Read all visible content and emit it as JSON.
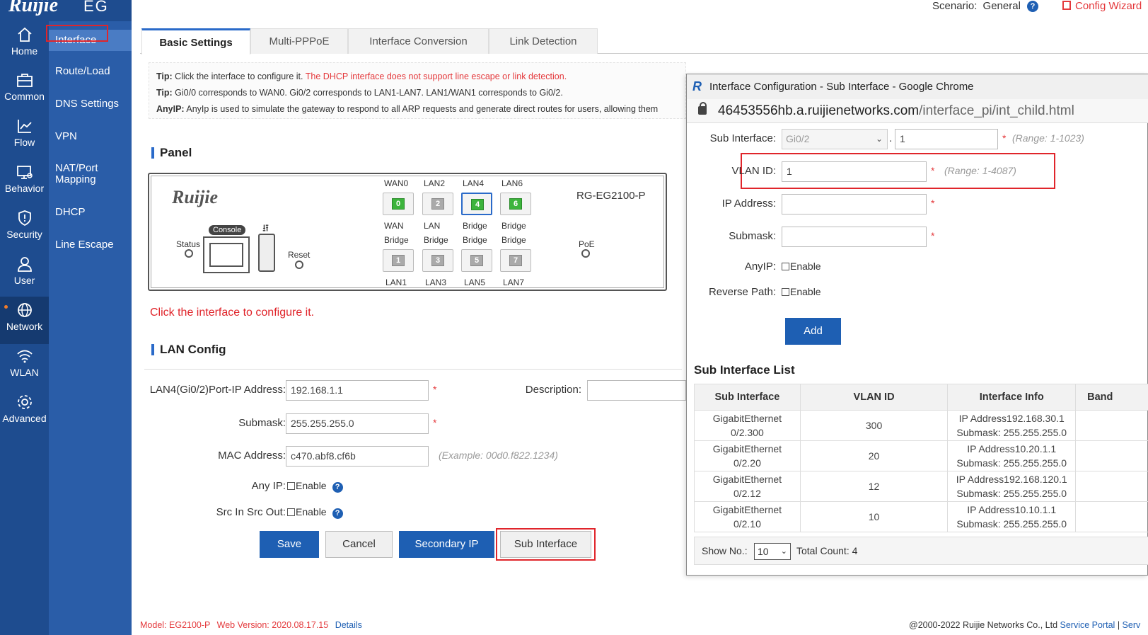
{
  "header": {
    "brand": "Ruijie",
    "product": "EG",
    "scenario_label": "Scenario:",
    "scenario_value": "General",
    "config_wizard": "Config Wizard"
  },
  "nav": {
    "items": [
      {
        "label": "Home",
        "icon": "home-icon"
      },
      {
        "label": "Common",
        "icon": "toolbox-icon"
      },
      {
        "label": "Flow",
        "icon": "chart-line-icon"
      },
      {
        "label": "Behavior",
        "icon": "monitor-icon"
      },
      {
        "label": "Security",
        "icon": "shield-icon"
      },
      {
        "label": "User",
        "icon": "user-icon"
      },
      {
        "label": "Network",
        "icon": "globe-icon"
      },
      {
        "label": "WLAN",
        "icon": "wifi-icon"
      },
      {
        "label": "Advanced",
        "icon": "gear-icon"
      }
    ],
    "active": "Network"
  },
  "submenu": {
    "items": [
      "Interface",
      "Route/Load",
      "DNS Settings",
      "VPN",
      "NAT/Port Mapping",
      "DHCP",
      "Line Escape"
    ],
    "nat_line1": "NAT/Port",
    "nat_line2": "Mapping"
  },
  "tabs": [
    "Basic Settings",
    "Multi-PPPoE",
    "Interface Conversion",
    "Link Detection"
  ],
  "tips": {
    "tip1_label": "Tip:",
    "tip1_text": "Click the interface to configure it.",
    "tip1_red": "The DHCP interface does not support line escape or link detection.",
    "tip2_label": "Tip:",
    "tip2_text": "Gi0/0 corresponds to WAN0. Gi0/2 corresponds to LAN1-LAN7. LAN1/WAN1 corresponds to Gi0/2.",
    "tip3_label": "AnyIP:",
    "tip3_text": "AnyIp is used to simulate the gateway to respond to all ARP requests and generate direct routes for users, allowing them"
  },
  "panel": {
    "title": "Panel",
    "brand": "Ruijie",
    "model": "RG-EG2100-P",
    "status_label": "Status",
    "console_label": "Console",
    "reset_label": "Reset",
    "poe_label": "PoE",
    "usb_symbol": "⭿",
    "top_ports": [
      {
        "name": "WAN0",
        "num": "0",
        "up": true,
        "role1": "WAN",
        "role2": "Bridge"
      },
      {
        "name": "LAN2",
        "num": "2",
        "up": false,
        "role1": "LAN",
        "role2": "Bridge"
      },
      {
        "name": "LAN4",
        "num": "4",
        "up": true,
        "role1": "Bridge",
        "role2": "Bridge"
      },
      {
        "name": "LAN6",
        "num": "6",
        "up": true,
        "role1": "Bridge",
        "role2": "Bridge"
      }
    ],
    "bottom_ports": [
      {
        "name": "LAN1",
        "num": "1",
        "up": false
      },
      {
        "name": "LAN3",
        "num": "3",
        "up": false
      },
      {
        "name": "LAN5",
        "num": "5",
        "up": false
      },
      {
        "name": "LAN7",
        "num": "7",
        "up": false
      }
    ]
  },
  "click_hint": "Click the interface to configure it.",
  "lan_config": {
    "title": "LAN Config",
    "port_ip_label": "LAN4(Gi0/2)Port-IP Address:",
    "port_ip_value": "192.168.1.1",
    "description_label": "Description:",
    "submask_label": "Submask:",
    "submask_value": "255.255.255.0",
    "mac_label": "MAC Address:",
    "mac_value": "c470.abf8.cf6b",
    "mac_hint": "(Example: 00d0.f822.1234)",
    "anyip_label": "Any IP:",
    "src_label": "Src In Src Out:",
    "enable": "Enable",
    "required": "*",
    "help": "?"
  },
  "buttons": {
    "save": "Save",
    "cancel": "Cancel",
    "secondary_ip": "Secondary IP",
    "sub_interface": "Sub Interface"
  },
  "footer": {
    "model_label": "Model:",
    "model_value": "EG2100-P",
    "web_label": "Web Version:",
    "web_value": "2020.08.17.15",
    "details": "Details",
    "copyright": "@2000-2022 Ruijie Networks Co., Ltd",
    "service_portal": "Service Portal",
    "sep": "|",
    "serv": "Serv"
  },
  "popup": {
    "title": "Interface Configuration - Sub Interface - Google Chrome",
    "url_domain": "46453556hb.a.ruijienetworks.com",
    "url_path": "/interface_pi/int_child.html",
    "sub_if_label": "Sub Interface:",
    "sub_if_select": "Gi0/2",
    "sub_if_dot": ".",
    "sub_if_value": "1",
    "sub_if_range": "(Range: 1-1023)",
    "vlan_label": "VLAN ID:",
    "vlan_value": "1",
    "vlan_range": "(Range: 1-4087)",
    "ip_label": "IP Address:",
    "submask_label": "Submask:",
    "anyip_label": "AnyIP:",
    "reverse_label": "Reverse Path:",
    "enable": "Enable",
    "add": "Add",
    "list_title": "Sub Interface List",
    "columns": [
      "Sub Interface",
      "VLAN ID",
      "Interface Info",
      "Band"
    ],
    "rows": [
      {
        "if1": "GigabitEthernet",
        "if2": "0/2.300",
        "vlan": "300",
        "info1": "IP Address192.168.30.1",
        "info2": "Submask: 255.255.255.0"
      },
      {
        "if1": "GigabitEthernet",
        "if2": "0/2.20",
        "vlan": "20",
        "info1": "IP Address10.20.1.1",
        "info2": "Submask: 255.255.255.0"
      },
      {
        "if1": "GigabitEthernet",
        "if2": "0/2.12",
        "vlan": "12",
        "info1": "IP Address192.168.120.1",
        "info2": "Submask: 255.255.255.0"
      },
      {
        "if1": "GigabitEthernet",
        "if2": "0/2.10",
        "vlan": "10",
        "info1": "IP Address10.10.1.1",
        "info2": "Submask: 255.255.255.0"
      }
    ],
    "show_no_label": "Show No.:",
    "show_no_value": "10",
    "total_count": "Total Count: 4"
  },
  "colors": {
    "nav_bg": "#1e4c8f",
    "submenu_bg": "#2a5da8",
    "primary": "#1e5fb3",
    "warning_red": "#e4393c",
    "port_up": "#3cb43c"
  }
}
